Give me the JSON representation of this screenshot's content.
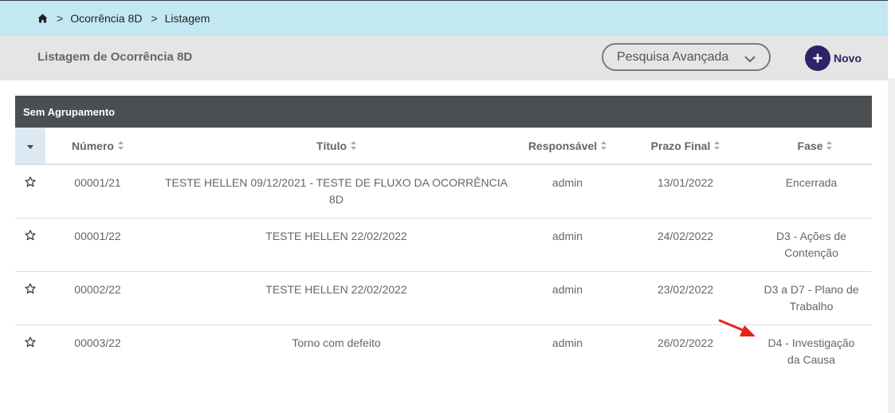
{
  "breadcrumb": {
    "items": [
      "Ocorrência 8D",
      "Listagem"
    ],
    "separator": ">"
  },
  "header": {
    "title": "Listagem de Ocorrência 8D",
    "advanced_search": "Pesquisa Avançada",
    "new_label": "Novo"
  },
  "table": {
    "group_label": "Sem Agrupamento",
    "columns": [
      "Número",
      "Título",
      "Responsável",
      "Prazo Final",
      "Fase"
    ],
    "rows": [
      {
        "numero": "00001/21",
        "titulo": "TESTE HELLEN 09/12/2021 - TESTE DE FLUXO DA OCORRÊNCIA 8D",
        "responsavel": "admin",
        "prazo": "13/01/2022",
        "fase": "Encerrada"
      },
      {
        "numero": "00001/22",
        "titulo": "TESTE HELLEN 22/02/2022",
        "responsavel": "admin",
        "prazo": "24/02/2022",
        "fase": "D3 - Ações de Contenção"
      },
      {
        "numero": "00002/22",
        "titulo": "TESTE HELLEN 22/02/2022",
        "responsavel": "admin",
        "prazo": "23/02/2022",
        "fase": "D3 a D7 - Plano de Trabalho"
      },
      {
        "numero": "00003/22",
        "titulo": "Torno com defeito",
        "responsavel": "admin",
        "prazo": "26/02/2022",
        "fase": "D4 - Investigação da Causa"
      }
    ]
  },
  "colors": {
    "breadcrumb_bg": "#c2e8f2",
    "group_header_bg": "#4b4f52",
    "accent": "#2e2368",
    "annotation_arrow": "#e8221b"
  },
  "icons": [
    "home-icon",
    "chevron-down-icon",
    "plus-icon",
    "sort-icon",
    "star-icon",
    "caret-down-icon"
  ]
}
